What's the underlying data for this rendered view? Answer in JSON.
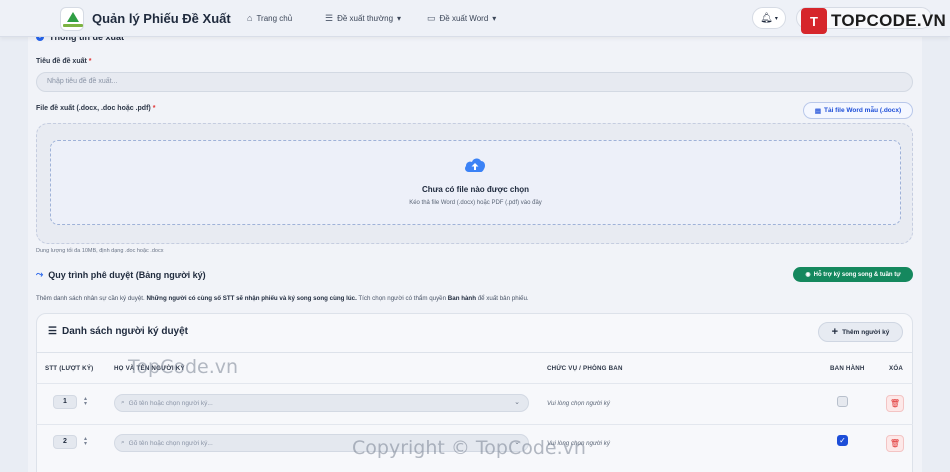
{
  "header": {
    "app_title": "Quản lý Phiếu Đề Xuất",
    "nav": [
      {
        "label": "Trang chủ",
        "icon": "home-icon",
        "glyph": "⌂"
      },
      {
        "label": "Đề xuất thường",
        "icon": "list-icon",
        "glyph": "☰",
        "caret": "▾"
      },
      {
        "label": "Đề xuất Word",
        "icon": "file-icon",
        "glyph": "▭",
        "caret": "▾"
      }
    ],
    "notifications_icon": "bell-icon",
    "watermark_badge": {
      "mark": "T",
      "text": "TOPCODE.VN"
    }
  },
  "info_section": {
    "heading": "Thông tin đề xuất",
    "title_label": "Tiêu đề đề xuất",
    "required_mark": "*",
    "title_placeholder": "Nhập tiêu đề đề xuất...",
    "file_label": "File đề xuất (.docx, .doc hoặc .pdf)",
    "template_button": "Tải file Word mẫu (.docx)",
    "dropzone_icon": "cloud-upload-icon",
    "dropzone_title": "Chưa có file nào được chọn",
    "dropzone_subtitle": "Kéo thả file Word (.docx) hoặc PDF (.pdf) vào đây",
    "file_hint": "Dung lượng tối đa 10MB, định dạng .doc hoặc .docx"
  },
  "approval_section": {
    "heading": "Quy trình phê duyệt (Bảng người ký)",
    "support_button": "Hỗ trợ ký song song & tuần tự",
    "description_start": "Thêm danh sách nhân sự cần ký duyệt. ",
    "description_bold": "Những người có cùng số STT sẽ nhận phiếu và ký song song cùng lúc.",
    "description_mid": " Tích chọn người có thẩm quyền ",
    "description_bold2": "Ban hành",
    "description_end": " để xuất bản phiếu.",
    "panel_title": "Danh sách người ký duyệt",
    "add_button": "Thêm người ký",
    "columns": [
      "STT (LƯỢT KÝ)",
      "HỌ VÀ TÊN NGƯỜI KÝ",
      "CHỨC VỤ / PHÒNG BAN",
      "BAN HÀNH",
      "XÓA"
    ],
    "rows": [
      {
        "order": "1",
        "picker_placeholder": "Gõ tên hoặc chọn người ký...",
        "role": "Vui lòng chọn người ký",
        "publish": false
      },
      {
        "order": "2",
        "picker_placeholder": "Gõ tên hoặc chọn người ký...",
        "role": "Vui lòng chọn người ký",
        "publish": true
      }
    ]
  },
  "watermarks": {
    "center": "TopCode.vn",
    "bottom": "Copyright © TopCode.vn"
  }
}
